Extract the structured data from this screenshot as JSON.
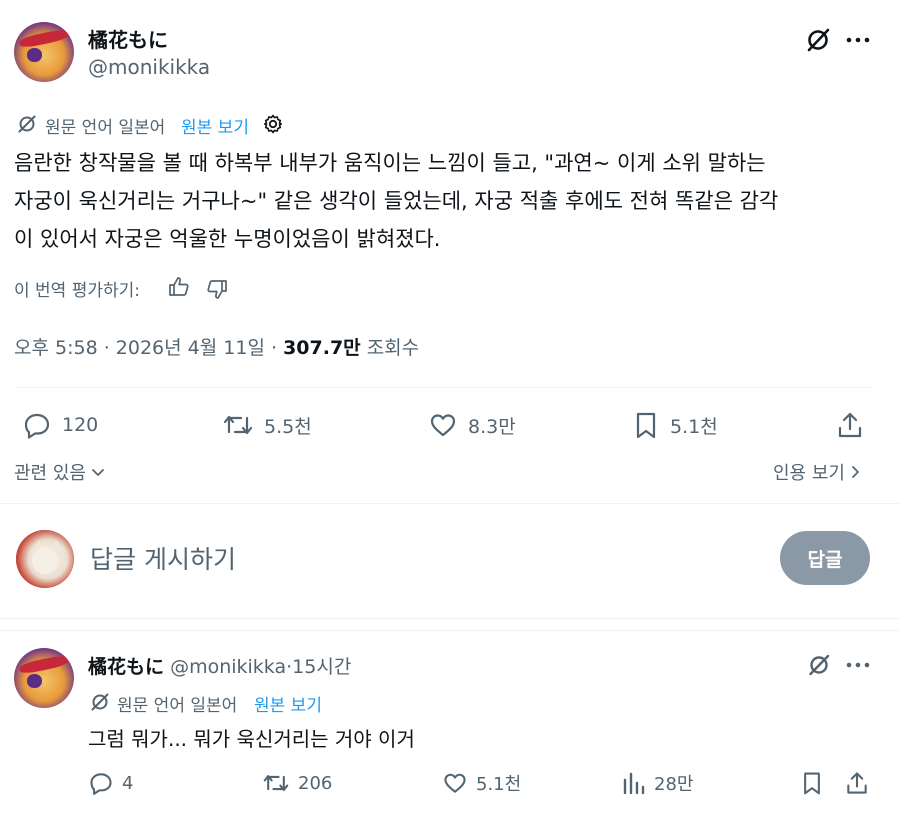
{
  "post": {
    "display_name": "橘花もに",
    "handle": "@monikikka",
    "translation_note": "원문 언어 일본어",
    "show_original": "원본 보기",
    "body_lines": [
      "음란한 창작물을 볼 때 하복부 내부가 움직이는 느낌이 들고, \"과연~ 이게 소위 말하는",
      "자궁이 욱신거리는 거구나~\" 같은 생각이 들었는데, 자궁 적출 후에도 전혀 똑같은 감각",
      "이 있어서 자궁은 억울한 누명이었음이 밝혀졌다."
    ],
    "rate_translation": "이 번역 평가하기:",
    "meta_time": "오후 5:58 · 2026년 4월 11일 ·",
    "meta_views_value": "307.7만",
    "meta_views_label": "조회수",
    "stats": {
      "replies": "120",
      "reposts": "5.5천",
      "likes": "8.3만",
      "bookmarks": "5.1천"
    },
    "related": "관련 있음",
    "quotes": "인용 보기"
  },
  "composer": {
    "placeholder": "답글 게시하기",
    "button": "답글"
  },
  "reply": {
    "display_name": "橘花もに",
    "handle": "@monikikka",
    "separator": "·",
    "time": "15시간",
    "translation_note": "원문 언어 일본어",
    "show_original": "원본 보기",
    "text": "그럼 뭐가... 뭐가 욱신거리는 거야 이거",
    "stats": {
      "replies": "4",
      "reposts": "206",
      "likes": "5.1천",
      "views": "28만"
    }
  },
  "colors": {
    "text": "#0f1419",
    "muted": "#536471",
    "accent": "#1d9bf0",
    "divider": "#eff3f4",
    "button_disabled": "#8b98a5"
  },
  "icons": [
    "grok-icon",
    "more-icon",
    "translate-icon",
    "gear-icon",
    "thumbs-up-icon",
    "thumbs-down-icon",
    "reply-icon",
    "repost-icon",
    "like-icon",
    "bookmark-icon",
    "share-icon",
    "chevron-down-icon",
    "chevron-right-icon",
    "views-icon"
  ]
}
